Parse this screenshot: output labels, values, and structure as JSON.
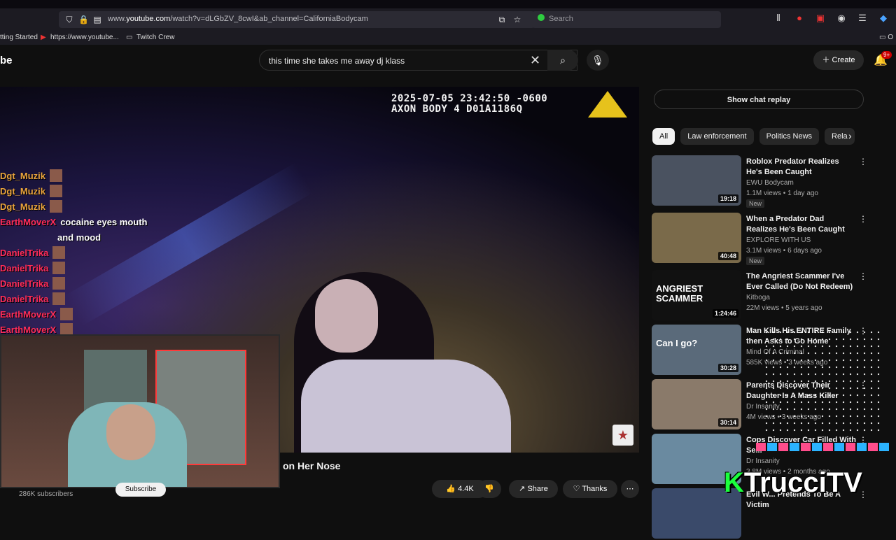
{
  "browser": {
    "url_prefix": "www.",
    "url_domain": "youtube.com",
    "url_rest": "/watch?v=dLGbZV_8cwI&ab_channel=CaliforniaBodycam",
    "search_placeholder": "Search",
    "bookmarks": [
      "tting Started",
      "https://www.youtube...",
      "Twitch Crew"
    ],
    "extension_badge": "2"
  },
  "youtube": {
    "logo_text": "be",
    "search_query": "this time she takes me away dj klass",
    "create_label": "Create",
    "notification_count": "9+"
  },
  "player": {
    "bodycam_line1": "2025-07-05 23:42:50 -0600",
    "bodycam_line2": "AXON BODY 4 D01A1186Q"
  },
  "chat": [
    {
      "user": "Dgt_Muzik",
      "color": "#e8a33c",
      "msg": ""
    },
    {
      "user": "Dgt_Muzik",
      "color": "#e8a33c",
      "msg": ""
    },
    {
      "user": "Dgt_Muzik",
      "color": "#e8a33c",
      "msg": ""
    },
    {
      "user": "EarthMoverX",
      "color": "#ff2d5a",
      "msg": "cocaine eyes mouth"
    },
    {
      "user": "",
      "color": "#ff2d5a",
      "msg": "and mood"
    },
    {
      "user": "DanielTrika",
      "color": "#ff2d5a",
      "msg": ""
    },
    {
      "user": "DanielTrika",
      "color": "#ff2d5a",
      "msg": ""
    },
    {
      "user": "DanielTrika",
      "color": "#ff2d5a",
      "msg": ""
    },
    {
      "user": "DanielTrika",
      "color": "#ff2d5a",
      "msg": ""
    },
    {
      "user": "EarthMoverX",
      "color": "#ff2d5a",
      "msg": ""
    },
    {
      "user": "EarthMoverX",
      "color": "#ff2d5a",
      "msg": ""
    },
    {
      "user": "EarthMoverX",
      "color": "#ff2d5a",
      "msg": ""
    }
  ],
  "video": {
    "title_fragment": "on Her Nose",
    "subscribers": "286K subscribers",
    "subscribe_label": "Subscribe",
    "like_count": "4.4K",
    "share_label": "Share",
    "thanks_label": "Thanks"
  },
  "sidebar": {
    "chat_replay_label": "Show chat replay",
    "chips": [
      "All",
      "Law enforcement",
      "Politics News",
      "Rela"
    ],
    "recommendations": [
      {
        "title": "Roblox Predator Realizes He's Been Caught",
        "channel": "EWU Bodycam",
        "meta": "1.1M views • 1 day ago",
        "duration": "19:18",
        "badge": "New",
        "thumb_text": "",
        "thumb_color": "#4a5260"
      },
      {
        "title": "When a Predator Dad Realizes He's Been Caught",
        "channel": "EXPLORE WITH US",
        "meta": "3.1M views • 6 days ago",
        "duration": "40:48",
        "badge": "New",
        "thumb_text": "",
        "thumb_color": "#7a6a4a"
      },
      {
        "title": "The Angriest Scammer I've Ever Called (Do Not Redeem)",
        "channel": "Kitboga",
        "meta": "22M views • 5 years ago",
        "duration": "1:24:46",
        "badge": "",
        "thumb_text": "ANGRIEST SCAMMER",
        "thumb_color": "#111111"
      },
      {
        "title": "Man Kills His ENTIRE Family then Asks to Go Home",
        "channel": "Mind Of A Criminal",
        "meta": "585K views • 3 weeks ago",
        "duration": "30:28",
        "badge": "",
        "thumb_text": "Can I go?",
        "thumb_color": "#5a6a7a"
      },
      {
        "title": "Parents Discover Their Daughter Is A Mass Killer",
        "channel": "Dr Insanity",
        "meta": "4M views • 3 weeks ago",
        "duration": "30:14",
        "badge": "",
        "thumb_text": "",
        "thumb_color": "#8a7a6a"
      },
      {
        "title": "Cops Discover Car Filled With Se...",
        "channel": "Dr Insanity",
        "meta": "3.8M views • 2 months ago",
        "duration": "",
        "badge": "",
        "thumb_text": "",
        "thumb_color": "#6a8aa0"
      },
      {
        "title": "Evil W... Pretends To Be A Victim",
        "channel": "",
        "meta": "",
        "duration": "",
        "badge": "",
        "thumb_text": "",
        "thumb_color": "#3a4a6a"
      }
    ]
  },
  "overlay": {
    "logo_k": "K",
    "logo_text": "TrucciTV"
  }
}
